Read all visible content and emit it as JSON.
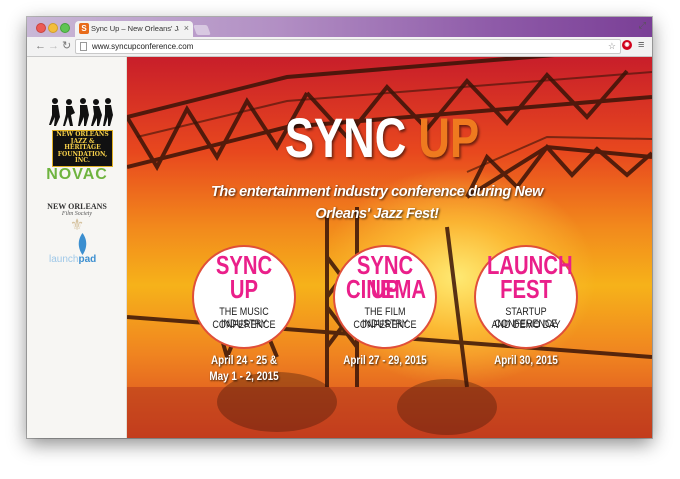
{
  "browser": {
    "tab_title": "Sync Up – New Orleans' Jaz",
    "tab_close": "×",
    "url": "www.syncupconference.com",
    "favicon_letter": "S"
  },
  "sidebar": {
    "jazz_line1": "NEW ORLEANS",
    "jazz_line2": "JAZZ & HERITAGE",
    "jazz_line3": "FOUNDATION, INC.",
    "novac": "NOVAC",
    "film_society_name": "NEW ORLEANS",
    "film_society_sub": "Film Society",
    "launchpad_light": "launch",
    "launchpad_bold": "pad"
  },
  "hero": {
    "title_main": "SYNC",
    "title_accent": "UP",
    "tagline_line1": "The entertainment industry conference during New",
    "tagline_line2": "Orleans' Jazz Fest!"
  },
  "events": [
    {
      "title_line1": "SYNC",
      "title_line2": "UP",
      "sub_line1": "THE MUSIC INDUSTRY",
      "sub_line2": "CONFERENCE",
      "date_line1": "April 24 - 25 &",
      "date_line2": "May 1 - 2, 2015"
    },
    {
      "title_line1": "SYNC UP",
      "title_line2": "CINEMA",
      "sub_line1": "THE FILM INDUSTRY",
      "sub_line2": "CONFERENCE",
      "date_line1": "April 27 - 29, 2015",
      "date_line2": ""
    },
    {
      "title_line1": "LAUNCH",
      "title_line2": "FEST",
      "sub_line1": "STARTUP CONFERENCE",
      "sub_line2": "AND DEMO DAY",
      "date_line1": "April 30, 2015",
      "date_line2": ""
    }
  ],
  "colors": {
    "accent_orange": "#ef7a1f",
    "event_pink": "#ea1f8a",
    "novac_green": "#6fb43f"
  }
}
